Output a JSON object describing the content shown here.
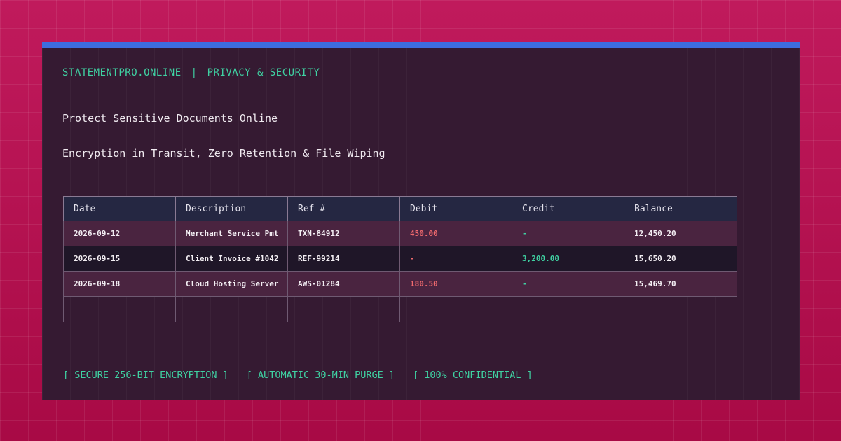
{
  "header": {
    "domain": "STATEMENTPRO.ONLINE",
    "separator": "|",
    "section": "PRIVACY & SECURITY"
  },
  "hero": {
    "title": "Protect Sensitive Documents Online",
    "subtitle": "Encryption in Transit, Zero Retention & File Wiping"
  },
  "table": {
    "columns": [
      "Date",
      "Description",
      "Ref #",
      "Debit",
      "Credit",
      "Balance"
    ],
    "rows": [
      {
        "date": "2026-09-12",
        "description": "Merchant Service Pmt",
        "ref": "TXN-84912",
        "debit": "450.00",
        "credit": "-",
        "balance": "12,450.20"
      },
      {
        "date": "2026-09-15",
        "description": "Client Invoice #1042",
        "ref": "REF-99214",
        "debit": "-",
        "credit": "3,200.00",
        "balance": "15,650.20"
      },
      {
        "date": "2026-09-18",
        "description": "Cloud Hosting Server",
        "ref": "AWS-01284",
        "debit": "180.50",
        "credit": "-",
        "balance": "15,469.70"
      }
    ]
  },
  "features": [
    "[ SECURE 256-BIT ENCRYPTION ]",
    "[ AUTOMATIC 30-MIN PURGE ]",
    "[ 100% CONFIDENTIAL ]"
  ],
  "colors": {
    "background": "#b3134f",
    "panel": "#351a32",
    "accent_bar": "#3d6de0",
    "accent_green": "#3fd1a2",
    "debit_red": "#f06a6e",
    "header_row": "#252742"
  }
}
